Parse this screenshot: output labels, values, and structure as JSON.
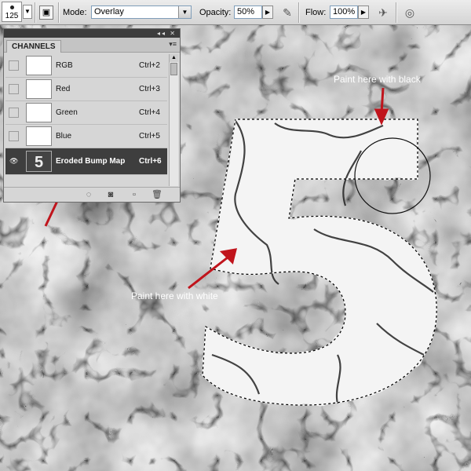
{
  "options_bar": {
    "brush_size": "125",
    "mode_label": "Mode:",
    "mode_value": "Overlay",
    "opacity_label": "Opacity:",
    "opacity_value": "50%",
    "flow_label": "Flow:",
    "flow_value": "100%",
    "icons": [
      "brush-preset-icon",
      "toggle-brush-panel-icon",
      "tablet-pressure-icon",
      "airbrush-icon",
      "tablet-size-icon"
    ]
  },
  "channels_panel": {
    "tab_label": "CHANNELS",
    "collapse_glyph": "◂◂",
    "close_glyph": "✕",
    "menu_glyph": "▾≡",
    "rows": [
      {
        "name": "RGB",
        "shortcut": "Ctrl+2",
        "visible": false,
        "selected": false
      },
      {
        "name": "Red",
        "shortcut": "Ctrl+3",
        "visible": false,
        "selected": false
      },
      {
        "name": "Green",
        "shortcut": "Ctrl+4",
        "visible": false,
        "selected": false
      },
      {
        "name": "Blue",
        "shortcut": "Ctrl+5",
        "visible": false,
        "selected": false
      },
      {
        "name": "Eroded Bump Map",
        "shortcut": "Ctrl+6",
        "visible": true,
        "selected": true
      }
    ],
    "eye_glyph": "👁",
    "bottom_icons": [
      "load-selection-icon",
      "save-selection-icon",
      "new-channel-icon",
      "delete-channel-icon"
    ]
  },
  "canvas": {
    "digit": "5",
    "annotation_black": "Paint here with black",
    "annotation_white": "Paint here with white",
    "arrow_color": "#c0141c",
    "selection_color": "#ffffff"
  }
}
